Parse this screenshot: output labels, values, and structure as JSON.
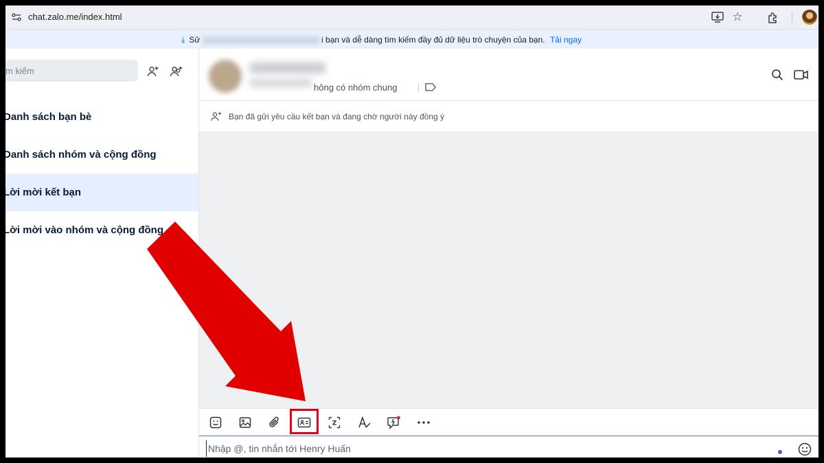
{
  "browser": {
    "url": "chat.zalo.me/index.html"
  },
  "banner": {
    "prefix": "Sử",
    "text": "i bạn và dễ dàng tìm kiếm đầy đủ dữ liệu trò chuyện của bạn.",
    "link": "Tải ngay"
  },
  "sidebar": {
    "search_placeholder": "m kiếm",
    "items": [
      {
        "label": "Danh sách bạn bè"
      },
      {
        "label": "Danh sách nhóm và cộng đồng"
      },
      {
        "label": "Lời mời kết bạn"
      },
      {
        "label": "Lời mời vào nhóm và cộng đồng"
      }
    ],
    "active_index": 2
  },
  "chat": {
    "header_status": "hông có nhóm chung",
    "notice": "Bạn đã gửi yêu cầu kết bạn và đang chờ người này đồng ý",
    "input_placeholder": "Nhập @, tin nhắn tới Henry Huấn",
    "toolbar_icons": [
      "sticker-icon",
      "image-icon",
      "attachment-icon",
      "contact-card-icon",
      "screenshot-icon",
      "text-format-icon",
      "quick-message-icon",
      "more-icon"
    ]
  },
  "colors": {
    "accent": "#0068ff",
    "active_bg": "#e5efff",
    "highlight": "#e3001b",
    "arrow": "#e00000"
  }
}
